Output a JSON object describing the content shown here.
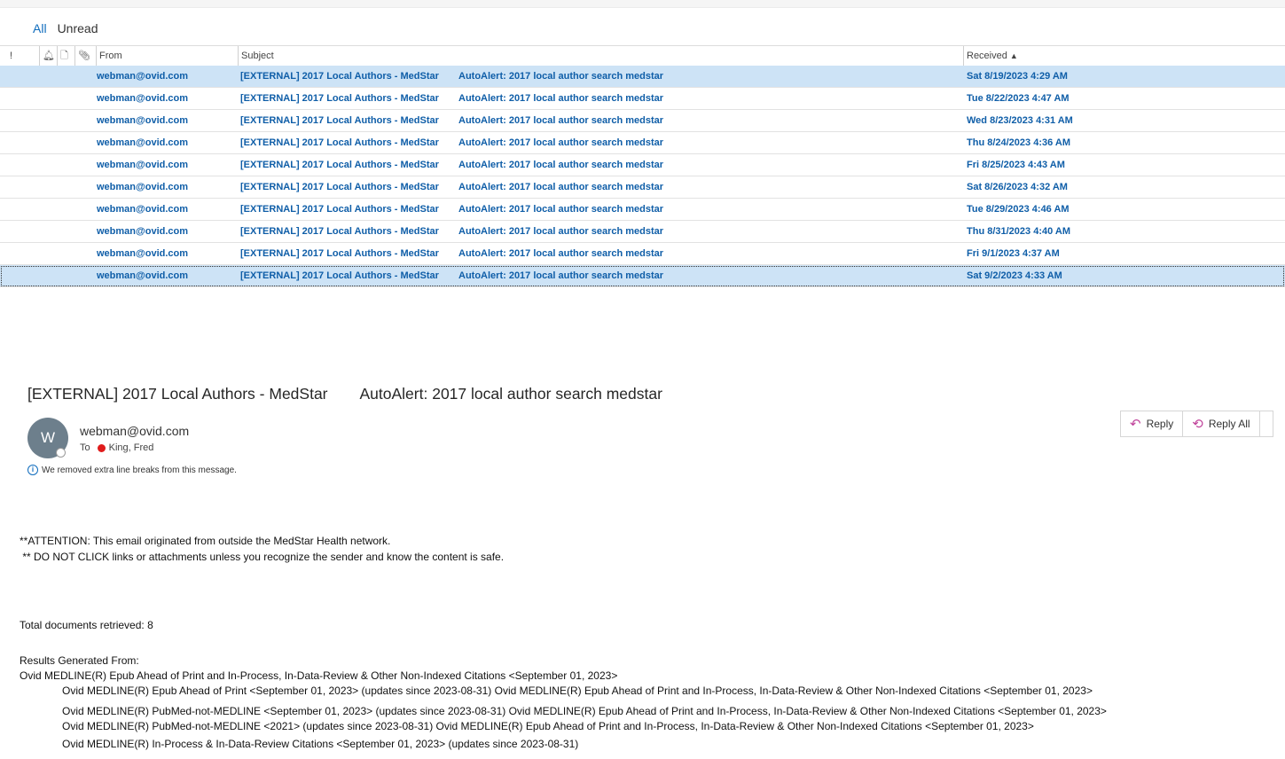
{
  "tabs": {
    "all": "All",
    "unread": "Unread"
  },
  "columns": {
    "importance": "!",
    "reminder_icon": "bell-icon",
    "doc_icon": "document-icon",
    "attach_icon": "paperclip-icon",
    "from": "From",
    "subject": "Subject",
    "received": "Received",
    "sort_indicator": "▲"
  },
  "messages": [
    {
      "from": "webman@ovid.com",
      "subject": "[EXTERNAL] 2017 Local Authors - MedStar",
      "preview": "AutoAlert: 2017 local author search medstar",
      "received": "Sat 8/19/2023 4:29 AM"
    },
    {
      "from": "webman@ovid.com",
      "subject": "[EXTERNAL] 2017 Local Authors - MedStar",
      "preview": "AutoAlert: 2017 local author search medstar",
      "received": "Tue 8/22/2023 4:47 AM"
    },
    {
      "from": "webman@ovid.com",
      "subject": "[EXTERNAL] 2017 Local Authors - MedStar",
      "preview": "AutoAlert: 2017 local author search medstar",
      "received": "Wed 8/23/2023 4:31 AM"
    },
    {
      "from": "webman@ovid.com",
      "subject": "[EXTERNAL] 2017 Local Authors - MedStar",
      "preview": "AutoAlert: 2017 local author search medstar",
      "received": "Thu 8/24/2023 4:36 AM"
    },
    {
      "from": "webman@ovid.com",
      "subject": "[EXTERNAL] 2017 Local Authors - MedStar",
      "preview": "AutoAlert: 2017 local author search medstar",
      "received": "Fri 8/25/2023 4:43 AM"
    },
    {
      "from": "webman@ovid.com",
      "subject": "[EXTERNAL] 2017 Local Authors - MedStar",
      "preview": "AutoAlert: 2017 local author search medstar",
      "received": "Sat 8/26/2023 4:32 AM"
    },
    {
      "from": "webman@ovid.com",
      "subject": "[EXTERNAL] 2017 Local Authors - MedStar",
      "preview": "AutoAlert: 2017 local author search medstar",
      "received": "Tue 8/29/2023 4:46 AM"
    },
    {
      "from": "webman@ovid.com",
      "subject": "[EXTERNAL] 2017 Local Authors - MedStar",
      "preview": "AutoAlert: 2017 local author search medstar",
      "received": "Thu 8/31/2023 4:40 AM"
    },
    {
      "from": "webman@ovid.com",
      "subject": "[EXTERNAL] 2017 Local Authors - MedStar",
      "preview": "AutoAlert: 2017 local author search medstar",
      "received": "Fri 9/1/2023 4:37 AM"
    },
    {
      "from": "webman@ovid.com",
      "subject": "[EXTERNAL] 2017 Local Authors - MedStar",
      "preview": "AutoAlert: 2017 local author search medstar",
      "received": "Sat 9/2/2023 4:33 AM"
    }
  ],
  "reading_pane": {
    "subject": "[EXTERNAL] 2017 Local Authors - MedStar",
    "subject_suffix": "AutoAlert: 2017 local author search medstar",
    "avatar_initial": "W",
    "sender": "webman@ovid.com",
    "to_label": "To",
    "recipient": "King, Fred",
    "info_message": "We removed extra line breaks from this message.",
    "reply_label": "Reply",
    "reply_all_label": "Reply All",
    "body": {
      "attention_1": "**ATTENTION: This email originated from outside the MedStar Health network.",
      "attention_2": " ** DO NOT CLICK links or attachments unless you recognize the sender and know the content is safe.",
      "total": "Total documents retrieved: 8",
      "results_from": "Results Generated From:",
      "source_main": "Ovid MEDLINE(R) Epub Ahead of Print and In-Process, In-Data-Review & Other Non-Indexed Citations <September 01, 2023>",
      "source_1": "Ovid MEDLINE(R) Epub Ahead of Print <September 01, 2023> (updates since 2023-08-31) Ovid MEDLINE(R) Epub Ahead of Print and In-Process, In-Data-Review & Other Non-Indexed Citations <September 01, 2023>",
      "source_2": "Ovid MEDLINE(R) PubMed-not-MEDLINE <September 01, 2023> (updates since 2023-08-31) Ovid MEDLINE(R) Epub Ahead of Print and In-Process, In-Data-Review & Other Non-Indexed Citations <September 01, 2023>",
      "source_3": "Ovid MEDLINE(R) PubMed-not-MEDLINE <2021> (updates since 2023-08-31) Ovid MEDLINE(R) Epub Ahead of Print and In-Process, In-Data-Review & Other Non-Indexed Citations <September 01, 2023>",
      "source_4": "Ovid MEDLINE(R) In-Process & In-Data-Review Citations <September 01, 2023> (updates since 2023-08-31)"
    }
  }
}
